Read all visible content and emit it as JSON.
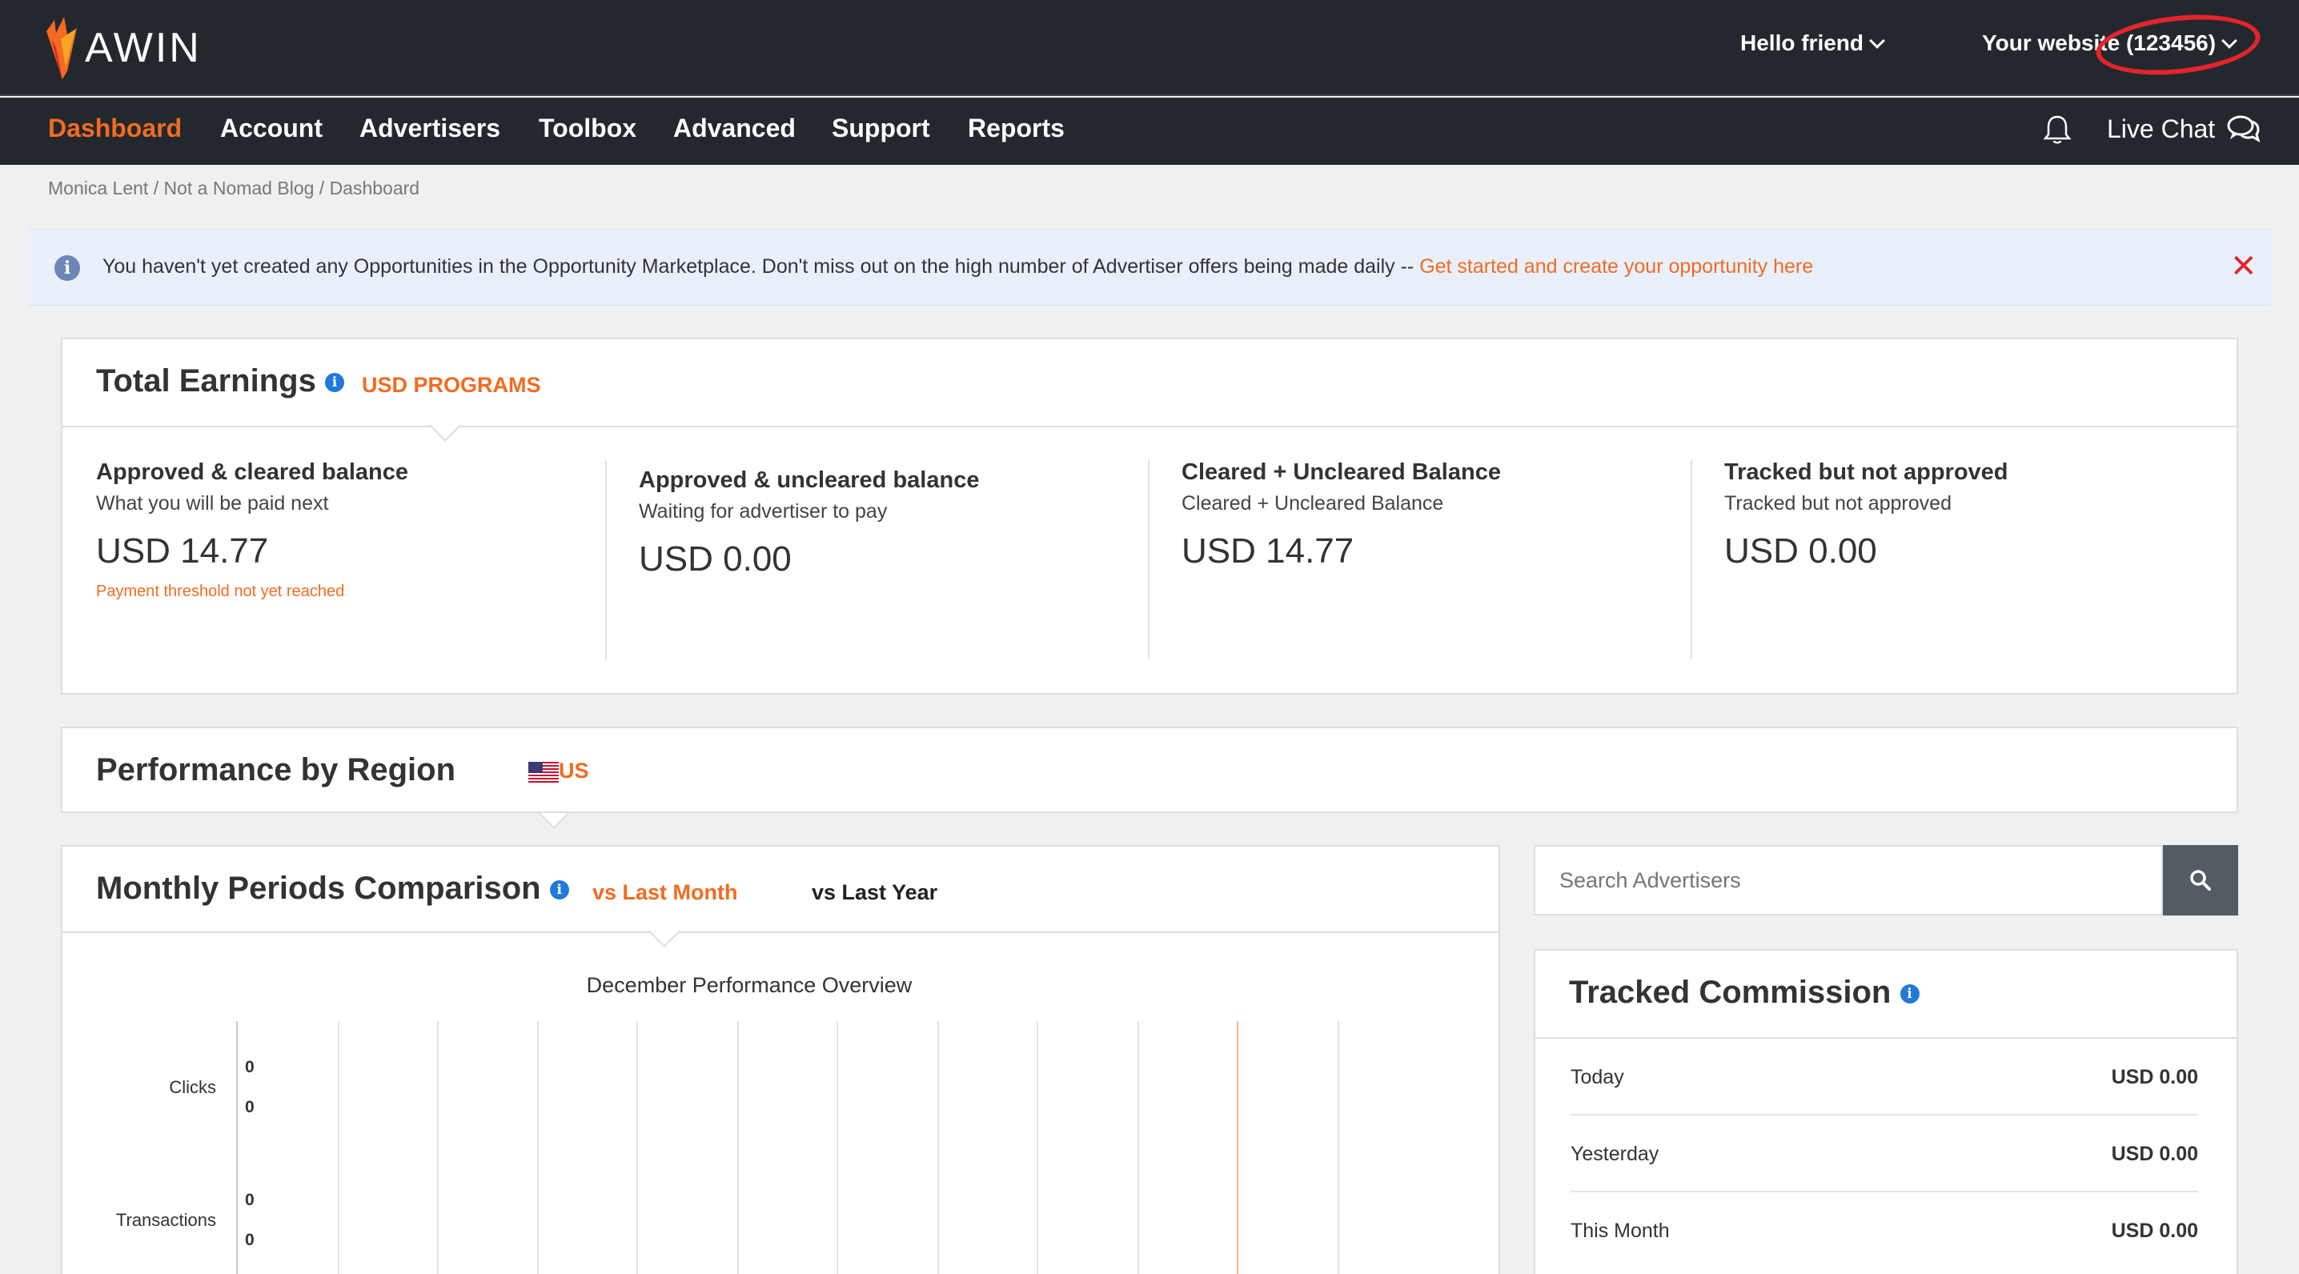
{
  "header": {
    "logo_text": "AWIN",
    "greeting": "Hello friend",
    "website": "Your website (123456)"
  },
  "nav": {
    "items": [
      "Dashboard",
      "Account",
      "Advertisers",
      "Toolbox",
      "Advanced",
      "Support",
      "Reports"
    ],
    "active": "Dashboard",
    "live_chat": "Live Chat"
  },
  "breadcrumb": "Monica Lent / Not a Nomad Blog / Dashboard",
  "banner": {
    "text": "You haven't yet created any Opportunities in the Opportunity Marketplace. Don't miss out on the high number of Advertiser offers being made daily -- ",
    "link": "Get started and create your opportunity here"
  },
  "total_earnings": {
    "title": "Total Earnings",
    "tab": "USD PROGRAMS",
    "balances": [
      {
        "title": "Approved & cleared balance",
        "sub": "What you will be paid next",
        "value": "USD 14.77",
        "note": "Payment threshold not yet reached"
      },
      {
        "title": "Approved & uncleared balance",
        "sub": "Waiting for advertiser to pay",
        "value": "USD 0.00",
        "note": ""
      },
      {
        "title": "Cleared + Uncleared Balance",
        "sub": "Cleared + Uncleared Balance",
        "value": "USD 14.77",
        "note": ""
      },
      {
        "title": "Tracked but not approved",
        "sub": "Tracked but not approved",
        "value": "USD 0.00",
        "note": ""
      }
    ]
  },
  "region": {
    "title": "Performance by Region",
    "country": "US"
  },
  "monthly": {
    "title": "Monthly Periods Comparison",
    "tab_active": "vs Last Month",
    "tab_other": "vs Last Year",
    "chart_title": "December Performance Overview",
    "metrics": [
      {
        "label": "Clicks",
        "values": [
          "0",
          "0"
        ]
      },
      {
        "label": "Transactions",
        "values": [
          "0",
          "0"
        ]
      }
    ]
  },
  "search": {
    "placeholder": "Search Advertisers"
  },
  "tracked_commission": {
    "title": "Tracked Commission",
    "rows": [
      {
        "label": "Today",
        "value": "USD 0.00"
      },
      {
        "label": "Yesterday",
        "value": "USD 0.00"
      },
      {
        "label": "This Month",
        "value": "USD 0.00"
      }
    ]
  },
  "colors": {
    "accent": "#f26b21",
    "header_bg": "#22282e",
    "alert_red": "#e4242c",
    "info_blue": "#1f7ad9"
  }
}
